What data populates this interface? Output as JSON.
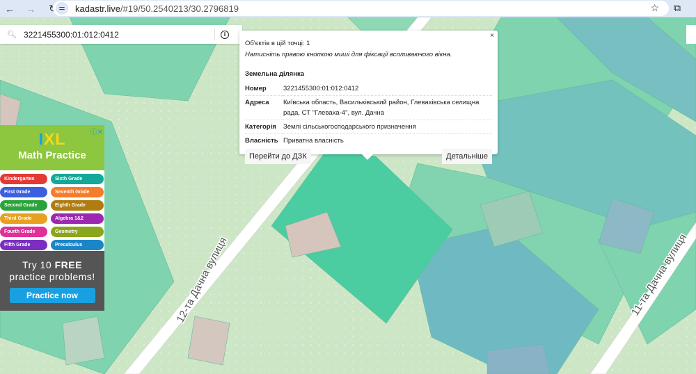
{
  "browser": {
    "url_host": "kadastr.live",
    "url_path": "/#19/50.2540213/30.2796819"
  },
  "search": {
    "value": "3221455300:01:012:0412"
  },
  "popup": {
    "objects_count": "Об'єктів в цій точці: 1",
    "hint": "Натисніть правою кнопкою миші для фіксації вспливаючого вікна.",
    "heading": "Земельна ділянка",
    "rows": [
      {
        "key": "Номер",
        "value": "3221455300:01:012:0412"
      },
      {
        "key": "Адреса",
        "value": "Київська область, Васильківський район, Глевахівська селищна рада, СТ \"Глеваха-4\", вул. Дачна"
      },
      {
        "key": "Категорія",
        "value": "Землі сільськогосподарського призначення"
      },
      {
        "key": "Власність",
        "value": "Приватна власність"
      }
    ],
    "btn_dzk": "Перейти до ДЗК",
    "btn_details": "Детальніше",
    "close": "×"
  },
  "map": {
    "street1": "12-та Дачна вулиця",
    "street2": "11-та Дачна вулиця"
  },
  "ad": {
    "logo": "IXL",
    "title": "Math Practice",
    "items": [
      {
        "label": "Kindergarten",
        "color": "#e53935"
      },
      {
        "label": "Sixth Grade",
        "color": "#14a89a"
      },
      {
        "label": "First Grade",
        "color": "#3b5fe0"
      },
      {
        "label": "Seventh Grade",
        "color": "#f57c2a"
      },
      {
        "label": "Second Grade",
        "color": "#2aa33a"
      },
      {
        "label": "Eighth Grade",
        "color": "#b07c10"
      },
      {
        "label": "Third Grade",
        "color": "#e8a020"
      },
      {
        "label": "Algebra 1&2",
        "color": "#9c27b0"
      },
      {
        "label": "Fourth Grade",
        "color": "#e0309a"
      },
      {
        "label": "Geometry",
        "color": "#8aa61c"
      },
      {
        "label": "Fifth Grade",
        "color": "#7b2fc0"
      },
      {
        "label": "Precalculus",
        "color": "#1a86c8"
      }
    ],
    "promo_line1": "Try 10 ",
    "promo_free": "FREE",
    "promo_line2": "practice problems!",
    "cta": "Practice now"
  }
}
